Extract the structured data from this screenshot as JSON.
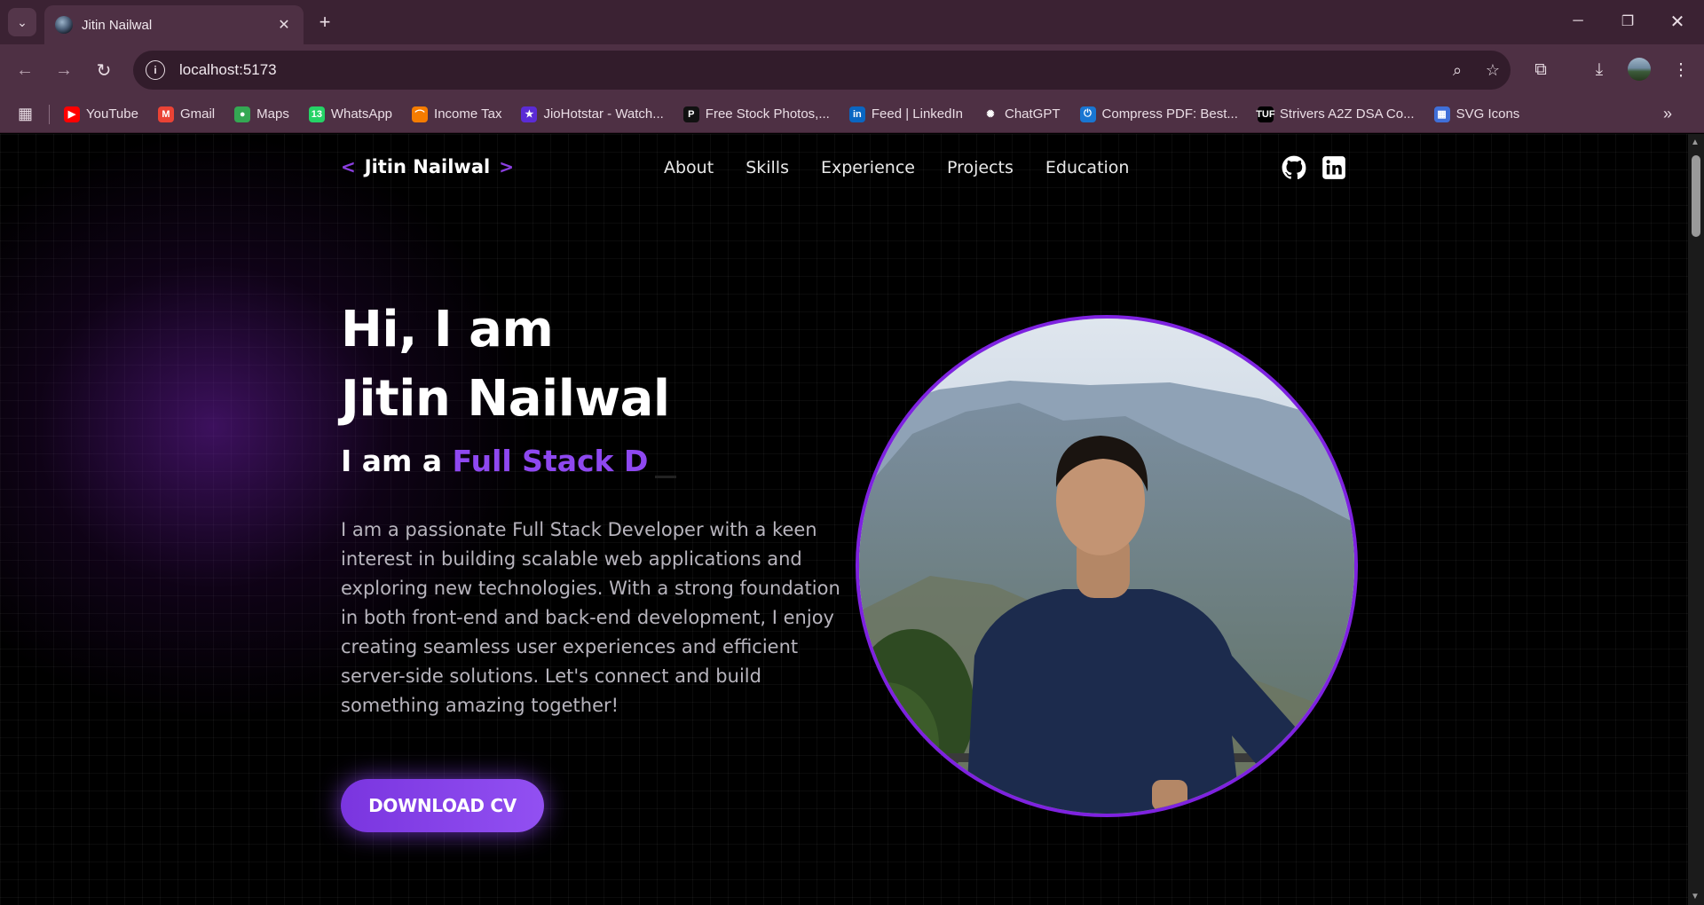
{
  "browser": {
    "tab_title": "Jitin Nailwal",
    "url": "localhost:5173",
    "bookmarks": [
      {
        "label": "YouTube",
        "color": "#ff0000",
        "glyph": "▶"
      },
      {
        "label": "Gmail",
        "color": "#ea4335",
        "glyph": "M"
      },
      {
        "label": "Maps",
        "color": "#34a853",
        "glyph": "●"
      },
      {
        "label": "WhatsApp",
        "color": "#25d366",
        "glyph": "13"
      },
      {
        "label": "Income Tax",
        "color": "#f57c00",
        "glyph": "⌒"
      },
      {
        "label": "JioHotstar - Watch...",
        "color": "#5b2bd6",
        "glyph": "★"
      },
      {
        "label": "Free Stock Photos,...",
        "color": "#111111",
        "glyph": "P"
      },
      {
        "label": "Feed | LinkedIn",
        "color": "#0a66c2",
        "glyph": "in"
      },
      {
        "label": "ChatGPT",
        "color": "#4e3044",
        "glyph": "✺"
      },
      {
        "label": "Compress PDF: Best...",
        "color": "#1976d2",
        "glyph": "⏻"
      },
      {
        "label": "Strivers A2Z DSA Co...",
        "color": "#000000",
        "glyph": "TUF"
      },
      {
        "label": "SVG Icons",
        "color": "#3f6fd8",
        "glyph": "▦"
      }
    ]
  },
  "site": {
    "logo_left": "<",
    "logo_name": "Jitin Nailwal",
    "logo_right": ">",
    "nav": [
      "About",
      "Skills",
      "Experience",
      "Projects",
      "Education"
    ],
    "social": [
      "github-icon",
      "linkedin-icon"
    ]
  },
  "hero": {
    "greeting": "Hi, I am",
    "name": "Jitin Nailwal",
    "role_prefix": "I am a ",
    "role_typed": "Full Stack D",
    "about": "I am a passionate Full Stack Developer with a keen interest in building scalable web applications and exploring new technologies. With a strong foundation in both front-end and back-end development, I enjoy creating seamless user experiences and efficient server-side solutions. Let's connect and build something amazing together!",
    "cta": "DOWNLOAD CV"
  },
  "colors": {
    "accent": "#8e48f0",
    "photo_border": "#7e22e0",
    "chrome": "#4e3044"
  }
}
